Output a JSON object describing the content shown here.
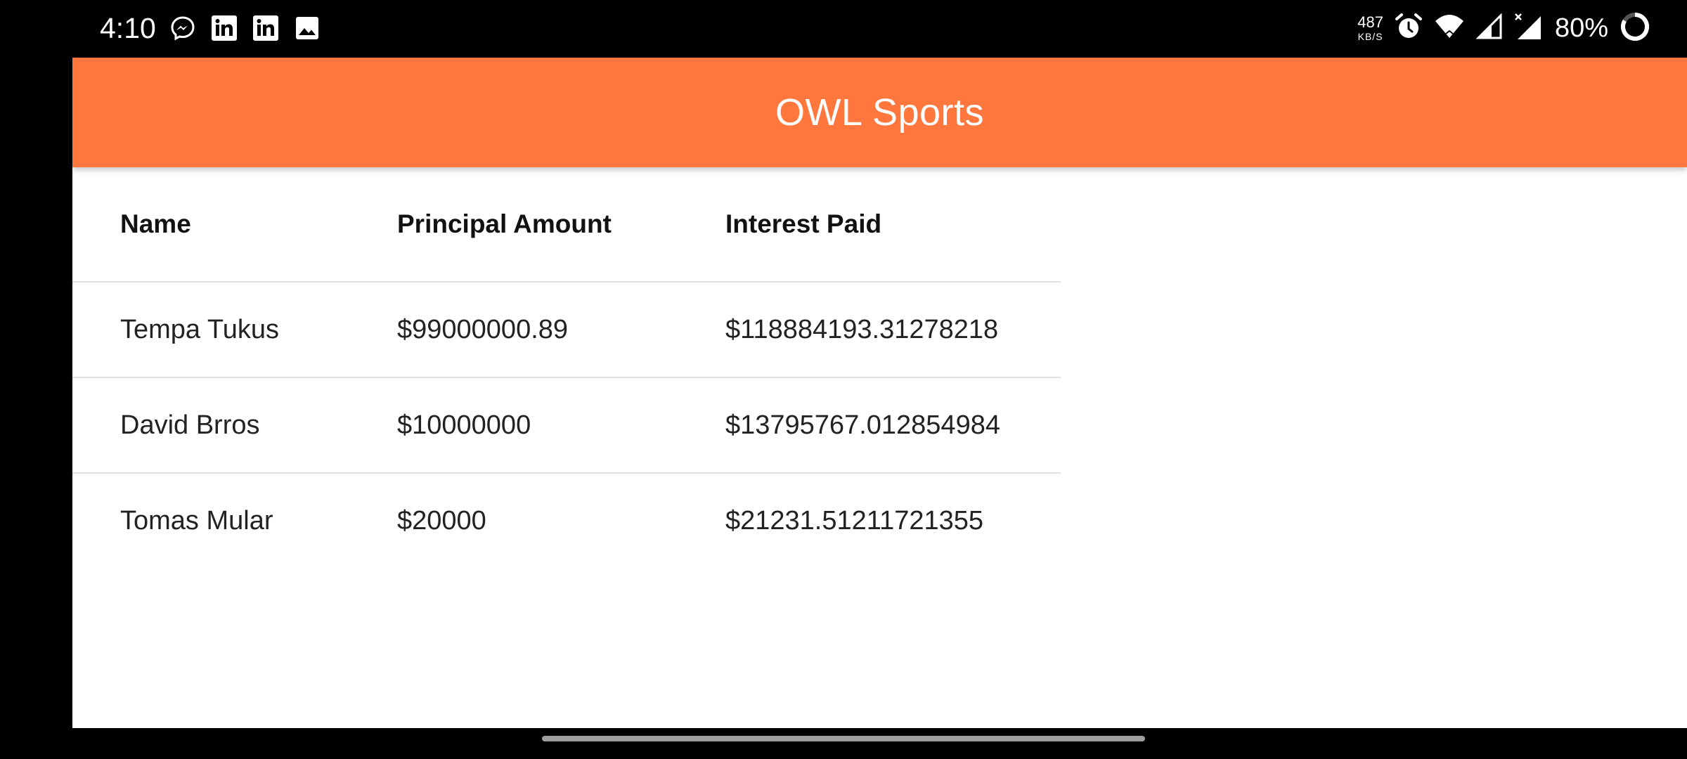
{
  "status_bar": {
    "time": "4:10",
    "left_icons": [
      "messenger-icon",
      "linkedin-icon",
      "linkedin-icon",
      "image-icon"
    ],
    "net_speed_value": "487",
    "net_speed_unit": "KB/S",
    "right_icons": [
      "alarm-icon",
      "wifi-icon",
      "signal-icon",
      "signal-x-icon"
    ],
    "battery": "80%"
  },
  "app_bar": {
    "title": "OWL Sports",
    "color": "#ff773d"
  },
  "table": {
    "headers": [
      "Name",
      "Principal Amount",
      "Interest Paid"
    ],
    "rows": [
      [
        "Tempa Tukus",
        "$99000000.89",
        "$118884193.31278218"
      ],
      [
        "David Brros",
        "$10000000",
        "$13795767.012854984"
      ],
      [
        "Tomas Mular",
        "$20000",
        "$21231.51211721355"
      ]
    ]
  }
}
